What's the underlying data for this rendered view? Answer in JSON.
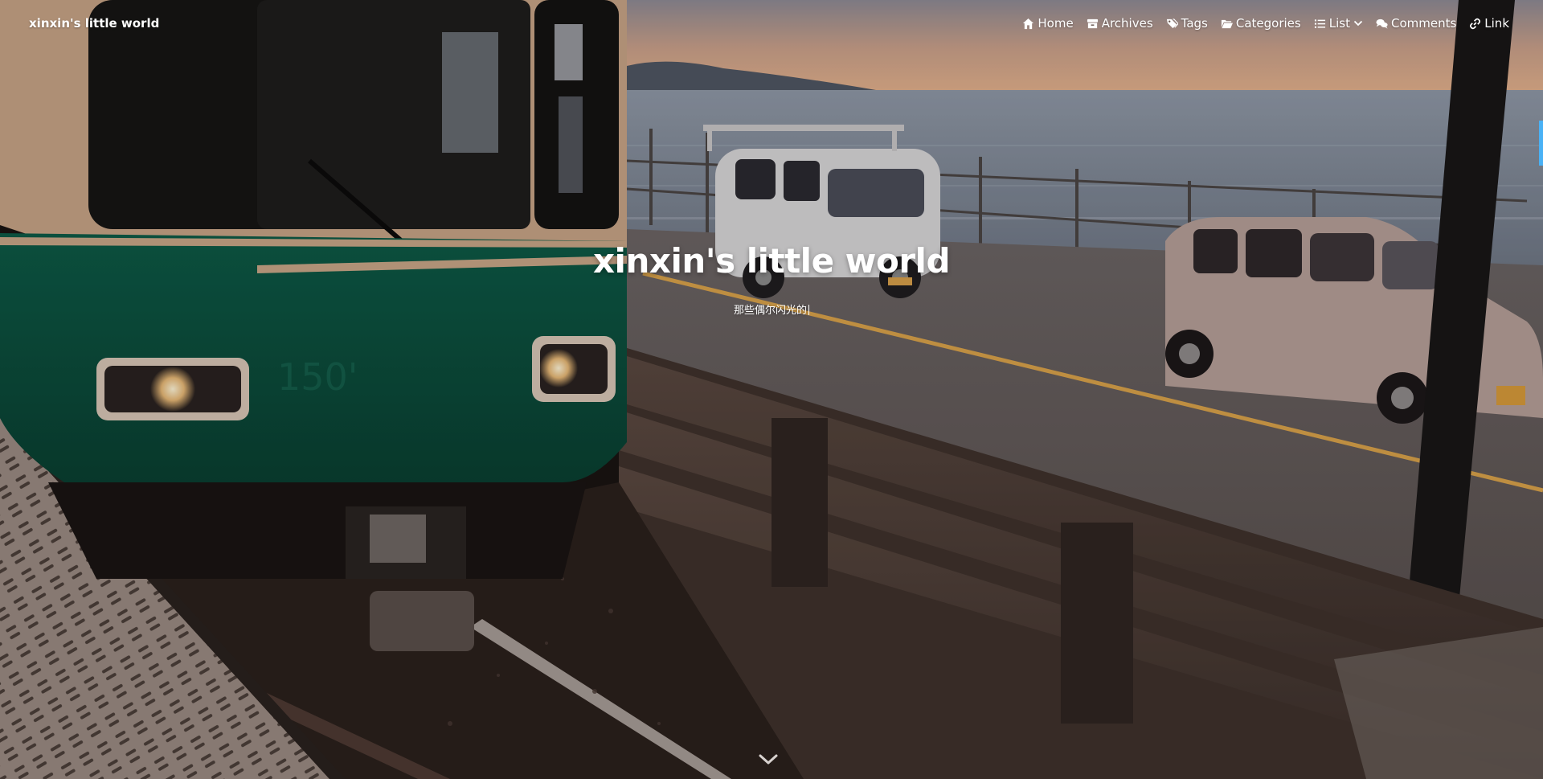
{
  "site": {
    "brand": "xinxin's little world"
  },
  "nav": {
    "items": [
      {
        "label": "Home",
        "icon": "home-icon"
      },
      {
        "label": "Archives",
        "icon": "archive-icon"
      },
      {
        "label": "Tags",
        "icon": "tags-icon"
      },
      {
        "label": "Categories",
        "icon": "folder-open-icon"
      },
      {
        "label": "List",
        "icon": "list-icon",
        "has_dropdown": true
      },
      {
        "label": "Comments",
        "icon": "comments-icon"
      },
      {
        "label": "Link",
        "icon": "link-icon"
      }
    ]
  },
  "hero": {
    "title": "xinxin's little world",
    "subtitle": "那些偶尔闪光的"
  },
  "scroll_hint": {
    "icon": "chevron-down-icon"
  },
  "colors": {
    "text": "#ffffff",
    "accent": "#49b1f5",
    "train_green": "#0f5a45",
    "sky_top": "#8d8c97",
    "sky_bottom": "#e7b48c",
    "sea": "#7b8795"
  }
}
